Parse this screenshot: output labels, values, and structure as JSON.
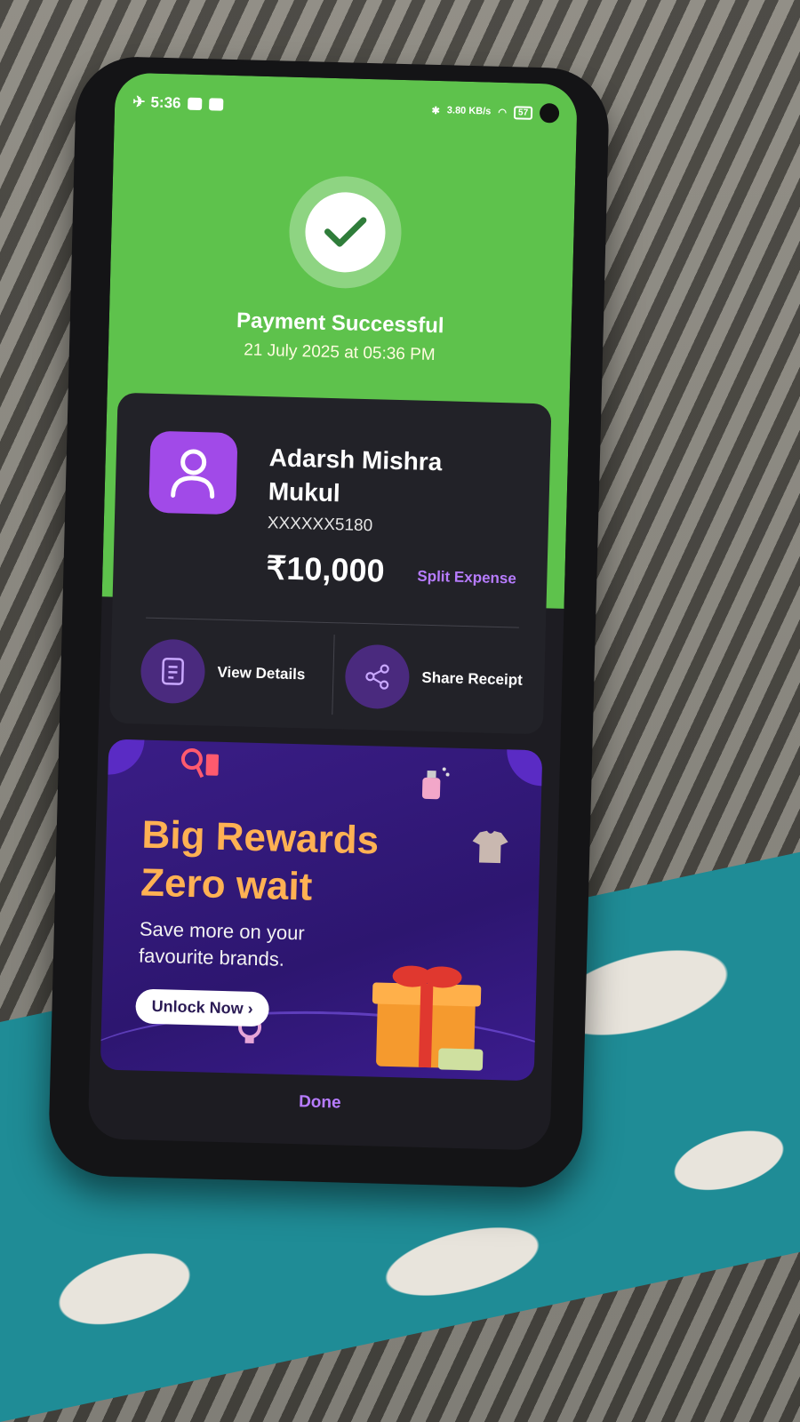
{
  "status_bar": {
    "time": "5:36",
    "network_speed": "3.80 KB/s",
    "battery": "57"
  },
  "payment": {
    "status_title": "Payment Successful",
    "timestamp": "21 July 2025 at 05:36 PM",
    "payee_name": "Adarsh Mishra Mukul",
    "account_masked": "XXXXXX5180",
    "amount": "₹10,000",
    "split_label": "Split Expense"
  },
  "actions": {
    "view_details": "View Details",
    "share_receipt": "Share Receipt"
  },
  "promo": {
    "headline_line1": "Big Rewards",
    "headline_line2": "Zero wait",
    "subtext": "Save more on your favourite brands.",
    "cta": "Unlock Now ›"
  },
  "footer": {
    "done_label": "Done"
  },
  "colors": {
    "success_green": "#5ec24c",
    "accent_purple": "#b77cff",
    "promo_orange": "#ffb153"
  }
}
